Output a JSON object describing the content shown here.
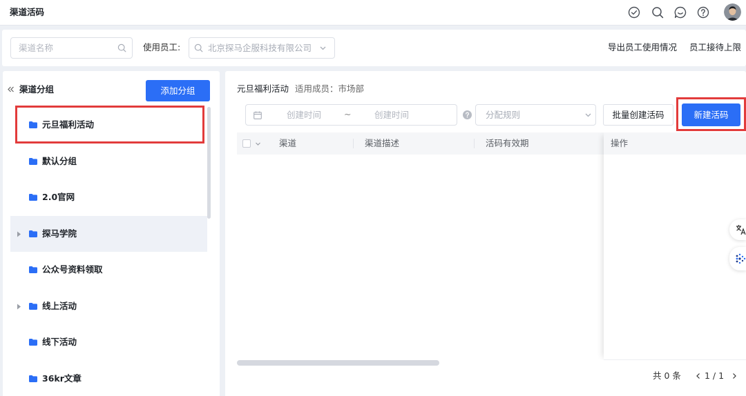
{
  "header": {
    "title": "渠道活码",
    "icons": [
      "check-circle-icon",
      "search-icon",
      "message-icon",
      "question-icon"
    ],
    "avatar": "avatar"
  },
  "toolbar": {
    "search": {
      "placeholder": "渠道名称",
      "value": ""
    },
    "employee_label": "使用员工:",
    "employee_select": {
      "placeholder": "北京探马企服科技有限公司"
    },
    "export_link": "导出员工使用情况",
    "limit_link": "员工接待上限"
  },
  "sidebar": {
    "title": "渠道分组",
    "add_button": "添加分组",
    "items": [
      {
        "label": "元旦福利活动",
        "expandable": false,
        "selected": true,
        "highlighted": true
      },
      {
        "label": "默认分组",
        "expandable": false
      },
      {
        "label": "2.0官网",
        "expandable": false
      },
      {
        "label": "探马学院",
        "expandable": true,
        "hovered": true
      },
      {
        "label": "公众号资料领取",
        "expandable": false
      },
      {
        "label": "线上活动",
        "expandable": true
      },
      {
        "label": "线下活动",
        "expandable": false
      },
      {
        "label": "36kr文章",
        "expandable": false
      }
    ]
  },
  "main": {
    "title": "元旦福利活动",
    "members": "适用成员：市场部",
    "filters": {
      "date_start": {
        "placeholder": "创建时间",
        "value": ""
      },
      "date_separator": "~",
      "date_end": {
        "placeholder": "创建时间",
        "value": ""
      },
      "rule_select": {
        "placeholder": "分配规则"
      }
    },
    "batch_button": "批量创建活码",
    "new_button": "新建活码",
    "new_button_highlighted": true,
    "table": {
      "columns": [
        "渠道",
        "渠道描述",
        "活码有效期",
        "操作"
      ],
      "rows": []
    },
    "pagination": {
      "total": "共 0 条",
      "page": "1 / 1"
    }
  },
  "colors": {
    "primary": "#2b6ef6",
    "highlight_box": "#e23b3b",
    "folder": "#2b6ef6",
    "hover_bg": "#eef1f7",
    "page_bg": "#edf0f5",
    "table_header_bg": "#f5f6f8"
  }
}
